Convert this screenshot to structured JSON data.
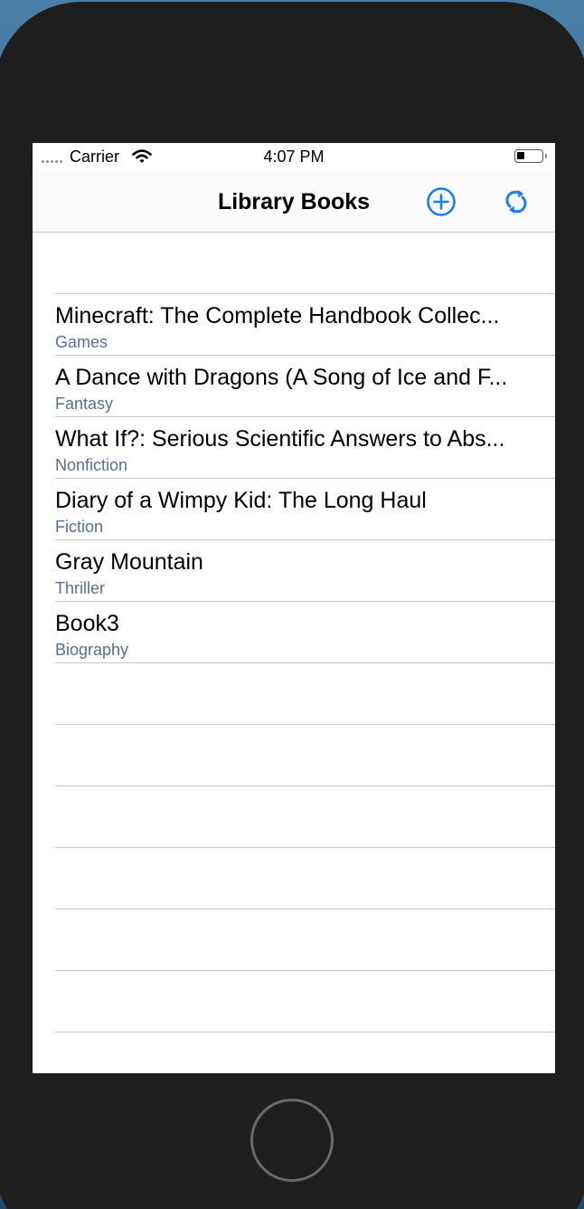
{
  "status_bar": {
    "carrier": "Carrier",
    "time": "4:07 PM",
    "battery_level": 0.3
  },
  "nav": {
    "title": "Library Books",
    "add_icon": "plus-circle-icon",
    "refresh_icon": "refresh-icon"
  },
  "colors": {
    "accent": "#1a7df0",
    "subtitle": "#5a6e8f",
    "separator": "#c8c7cc"
  },
  "books": [
    {
      "title": "Minecraft: The Complete Handbook Collec...",
      "genre": "Games"
    },
    {
      "title": "A Dance with Dragons (A Song of Ice and F...",
      "genre": "Fantasy"
    },
    {
      "title": "What If?: Serious Scientific Answers to Abs...",
      "genre": "Nonfiction"
    },
    {
      "title": "Diary of a Wimpy Kid: The Long Haul",
      "genre": "Fiction"
    },
    {
      "title": "Gray Mountain",
      "genre": "Thriller"
    },
    {
      "title": "Book3",
      "genre": "Biography"
    }
  ]
}
